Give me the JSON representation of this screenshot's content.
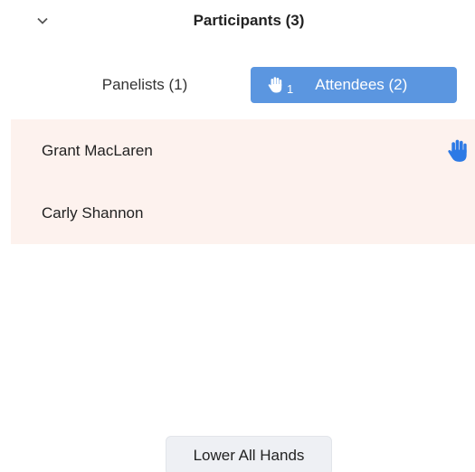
{
  "header": {
    "title": "Participants (3)",
    "collapse_icon": "chevron-down-icon"
  },
  "tabs": {
    "panelists": {
      "label": "Panelists (1)",
      "selected": false
    },
    "attendees": {
      "label": "Attendees (2)",
      "selected": true,
      "raised_hands": "1",
      "icon": "raised-hand-icon"
    }
  },
  "attendees": [
    {
      "name": "Grant MacLaren",
      "hand_raised": true
    },
    {
      "name": "Carly Shannon",
      "hand_raised": false
    }
  ],
  "footer": {
    "lower_all_label": "Lower All Hands"
  },
  "colors": {
    "accent": "#5b96e0",
    "hand": "#2d7ae5",
    "list_highlight": "#fdf2ee"
  }
}
